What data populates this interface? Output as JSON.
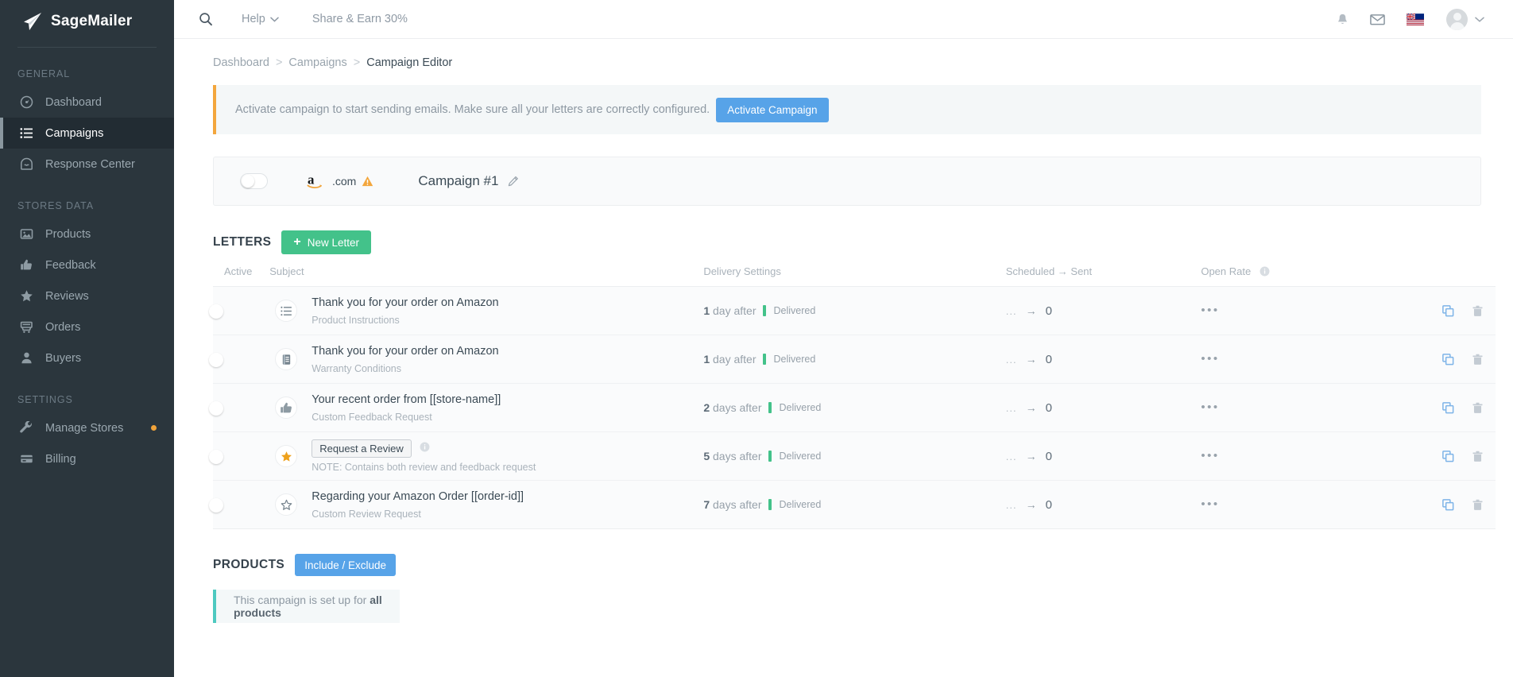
{
  "sidebar": {
    "brand": "SageMailer",
    "groups": [
      {
        "title": "GENERAL",
        "items": [
          {
            "label": "Dashboard",
            "icon": "dashboard-icon",
            "active": false,
            "dot": false
          },
          {
            "label": "Campaigns",
            "icon": "list-icon",
            "active": true,
            "dot": false
          },
          {
            "label": "Response Center",
            "icon": "inbox-icon",
            "active": false,
            "dot": false
          }
        ]
      },
      {
        "title": "STORES DATA",
        "items": [
          {
            "label": "Products",
            "icon": "image-icon",
            "active": false,
            "dot": false
          },
          {
            "label": "Feedback",
            "icon": "thumbs-up-icon",
            "active": false,
            "dot": false
          },
          {
            "label": "Reviews",
            "icon": "star-icon",
            "active": false,
            "dot": false
          },
          {
            "label": "Orders",
            "icon": "cart-icon",
            "active": false,
            "dot": false
          },
          {
            "label": "Buyers",
            "icon": "user-icon",
            "active": false,
            "dot": false
          }
        ]
      },
      {
        "title": "SETTINGS",
        "items": [
          {
            "label": "Manage Stores",
            "icon": "wrench-icon",
            "active": false,
            "dot": true
          },
          {
            "label": "Billing",
            "icon": "credit-card-icon",
            "active": false,
            "dot": false
          }
        ]
      }
    ]
  },
  "topbar": {
    "search_icon": "search-icon",
    "help_label": "Help",
    "share_label": "Share & Earn 30%",
    "bell_icon": "bell-icon",
    "mail_icon": "mail-icon",
    "flag_icon": "uk-flag-icon",
    "avatar_icon": "avatar",
    "caret_icon": "chevron-down-icon"
  },
  "breadcrumb": {
    "items": [
      "Dashboard",
      "Campaigns",
      "Campaign Editor"
    ],
    "separator": ">"
  },
  "alert": {
    "text": "Activate campaign to start sending emails. Make sure all your letters are correctly configured.",
    "button_label": "Activate Campaign",
    "accent_color": "#f3a63d"
  },
  "campaign": {
    "enabled": false,
    "marketplace": ".com",
    "marketplace_icon": "amazon-icon",
    "warning_icon": "warning-triangle-icon",
    "name": "Campaign #1",
    "edit_icon": "pencil-icon"
  },
  "letters": {
    "section_title": "LETTERS",
    "new_letter_label": "New Letter",
    "new_letter_plus": "+",
    "columns": {
      "active": "Active",
      "subject": "Subject",
      "delivery": "Delivery Settings",
      "scheduled": "Scheduled → Sent",
      "open_rate": "Open Rate",
      "open_rate_info_icon": "info-icon"
    },
    "rows": [
      {
        "active": true,
        "icon": "checklist-icon",
        "subject": "Thank you for your order on Amazon",
        "subtitle": "Product Instructions",
        "is_button_subject": false,
        "delivery_num": "1",
        "delivery_unit": "day after",
        "status": "Delivered",
        "scheduled": "...",
        "arrow": "→",
        "sent": "0",
        "open_rate": "•••",
        "copy_icon": "copy-icon",
        "delete_icon": "trash-icon"
      },
      {
        "active": true,
        "icon": "document-icon",
        "subject": "Thank you for your order on Amazon",
        "subtitle": "Warranty Conditions",
        "is_button_subject": false,
        "delivery_num": "1",
        "delivery_unit": "day after",
        "status": "Delivered",
        "scheduled": "...",
        "arrow": "→",
        "sent": "0",
        "open_rate": "•••",
        "copy_icon": "copy-icon",
        "delete_icon": "trash-icon"
      },
      {
        "active": true,
        "icon": "thumbs-up-icon",
        "subject": "Your recent order from [[store-name]]",
        "subtitle": "Custom Feedback Request",
        "is_button_subject": false,
        "delivery_num": "2",
        "delivery_unit": "days after",
        "status": "Delivered",
        "scheduled": "...",
        "arrow": "→",
        "sent": "0",
        "open_rate": "•••",
        "copy_icon": "copy-icon",
        "delete_icon": "trash-icon"
      },
      {
        "active": true,
        "icon": "star-filled-icon",
        "subject": "Request a Review",
        "subtitle": "NOTE: Contains both review and feedback request",
        "is_button_subject": true,
        "subject_info_icon": "info-icon",
        "delivery_num": "5",
        "delivery_unit": "days after",
        "status": "Delivered",
        "scheduled": "...",
        "arrow": "→",
        "sent": "0",
        "open_rate": "•••",
        "copy_icon": "copy-icon",
        "delete_icon": "trash-icon"
      },
      {
        "active": true,
        "icon": "star-outline-icon",
        "subject": "Regarding your Amazon Order [[order-id]]",
        "subtitle": "Custom Review Request",
        "is_button_subject": false,
        "delivery_num": "7",
        "delivery_unit": "days after",
        "status": "Delivered",
        "scheduled": "...",
        "arrow": "→",
        "sent": "0",
        "open_rate": "•••",
        "copy_icon": "copy-icon",
        "delete_icon": "trash-icon"
      }
    ]
  },
  "products": {
    "section_title": "PRODUCTS",
    "button_label": "Include / Exclude",
    "note_prefix": "This campaign is set up for ",
    "note_bold": "all products",
    "accent_color": "#4ec9c0"
  },
  "colors": {
    "sidebar_bg": "#2b363d",
    "accent_blue": "#57a3e8",
    "accent_green": "#43c28a",
    "accent_orange": "#f3a63d",
    "accent_teal": "#4ec9c0"
  }
}
